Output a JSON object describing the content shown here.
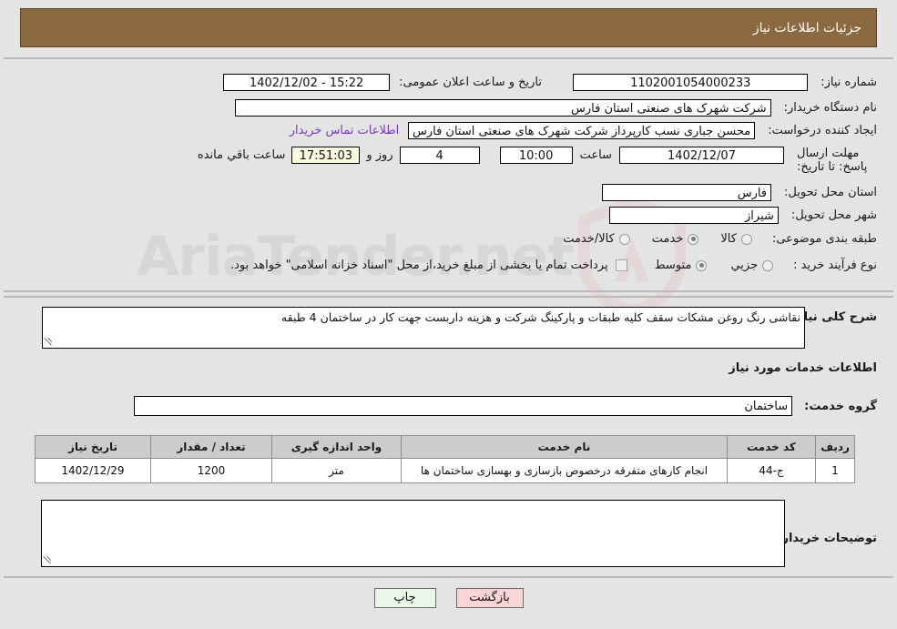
{
  "header": {
    "title": "جزئیات اطلاعات نیاز"
  },
  "top": {
    "need_number_label": "شماره نیاز:",
    "need_number_value": "1102001054000233",
    "announce_label": "تاریخ و ساعت اعلان عمومی:",
    "announce_value": "15:22 - 1402/12/02",
    "buyer_org_label": "نام دستگاه خریدار:",
    "buyer_org_value": "شرکت شهرک های صنعتی استان فارس",
    "creator_label": "ایجاد کننده درخواست:",
    "creator_value": "محسن  جباری نسب کارپرداز شرکت شهرک های صنعتی استان فارس",
    "contact_link": "اطلاعات تماس خریدار",
    "deadline_label": "مهلت ارسال پاسخ: تا تاریخ:",
    "deadline_date": "1402/12/07",
    "hour_label": "ساعت",
    "deadline_time": "10:00",
    "days_value": "4",
    "days_unit": "روز و",
    "countdown_value": "17:51:03",
    "countdown_unit": "ساعت باقي مانده",
    "province_label": "استان محل تحویل:",
    "province_value": "فارس",
    "city_label": "شهر محل تحویل:",
    "city_value": "شیراز",
    "category_label": "طبقه بندی موضوعی:",
    "category_options": [
      {
        "label": "کالا",
        "selected": false
      },
      {
        "label": "خدمت",
        "selected": true
      },
      {
        "label": "کالا/خدمت",
        "selected": false
      }
    ],
    "process_label": "نوع فرآیند خرید :",
    "process_options": [
      {
        "label": "جزیي",
        "selected": false
      },
      {
        "label": "متوسط",
        "selected": true
      }
    ],
    "treasury_note": "پرداخت تمام یا بخشی از مبلغ خرید،از محل \"اسناد خزانه اسلامی\" خواهد بود."
  },
  "mid": {
    "summary_label": "شرح کلی نیاز:",
    "summary_value": "نقاشی رنگ روغن مشکات سقف کلیه طبقات و پارکینگ شرکت  و هزینه داربست جهت کار در ساختمان 4 طبقه",
    "section_title": "اطلاعات خدمات مورد نیاز",
    "service_group_label": "گروه خدمت:",
    "service_group_value": "ساختمان",
    "buyer_notes_label": "توضیحات خریدار:",
    "buyer_notes_value": ""
  },
  "table": {
    "headers": [
      "ردیف",
      "کد خدمت",
      "نام خدمت",
      "واحد اندازه گیری",
      "تعداد / مقدار",
      "تاریخ نیاز"
    ],
    "rows": [
      {
        "row": "1",
        "code": "ج-44",
        "name": "انجام کارهای متفرقه درخصوص بازسازی و بهسازی ساختمان ها",
        "unit": "متر",
        "qty": "1200",
        "date": "1402/12/29"
      }
    ]
  },
  "buttons": {
    "print": "چاپ",
    "back": "بازگشت"
  },
  "watermark": {
    "text": "AriaTender.net"
  }
}
